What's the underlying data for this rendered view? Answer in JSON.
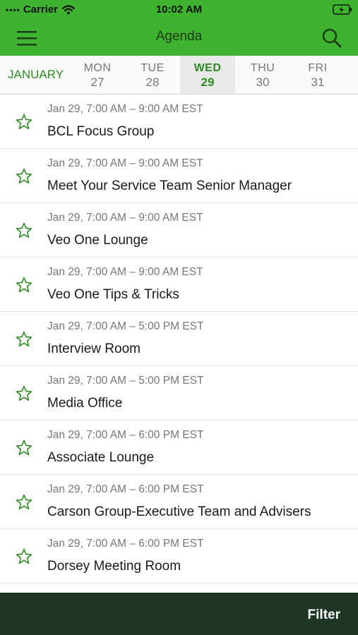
{
  "status": {
    "carrier": "Carrier",
    "time": "10:02 AM",
    "signal_icon": "signal-dots-icon",
    "wifi_icon": "wifi-icon",
    "battery_icon": "battery-charging-icon"
  },
  "nav": {
    "title": "Agenda",
    "menu_icon": "hamburger-menu-icon",
    "search_icon": "search-icon"
  },
  "calendar": {
    "month": "JANUARY",
    "days": [
      {
        "name": "MON",
        "num": "27"
      },
      {
        "name": "TUE",
        "num": "28"
      },
      {
        "name": "WED",
        "num": "29"
      },
      {
        "name": "THU",
        "num": "30"
      },
      {
        "name": "FRI",
        "num": "31"
      }
    ]
  },
  "sessions": [
    {
      "time": "Jan 29, 7:00 AM – 9:00 AM EST",
      "name": "BCL Focus Group"
    },
    {
      "time": "Jan 29, 7:00 AM – 9:00 AM EST",
      "name": "Meet Your Service Team Senior Manager"
    },
    {
      "time": "Jan 29, 7:00 AM – 9:00 AM EST",
      "name": "Veo One Lounge"
    },
    {
      "time": "Jan 29, 7:00 AM – 9:00 AM EST",
      "name": "Veo One Tips & Tricks"
    },
    {
      "time": "Jan 29, 7:00 AM – 5:00 PM EST",
      "name": "Interview Room"
    },
    {
      "time": "Jan 29, 7:00 AM – 5:00 PM EST",
      "name": "Media Office"
    },
    {
      "time": "Jan 29, 7:00 AM – 6:00 PM EST",
      "name": "Associate Lounge"
    },
    {
      "time": "Jan 29, 7:00 AM – 6:00 PM EST",
      "name": "Carson Group-Executive Team and Advisers"
    },
    {
      "time": "Jan 29, 7:00 AM – 6:00 PM EST",
      "name": "Dorsey Meeting Room"
    }
  ],
  "footer": {
    "filter_label": "Filter"
  },
  "colors": {
    "brand_green": "#3eb32f",
    "accent_green": "#2e8b24",
    "footer_bg": "#1e3625"
  }
}
